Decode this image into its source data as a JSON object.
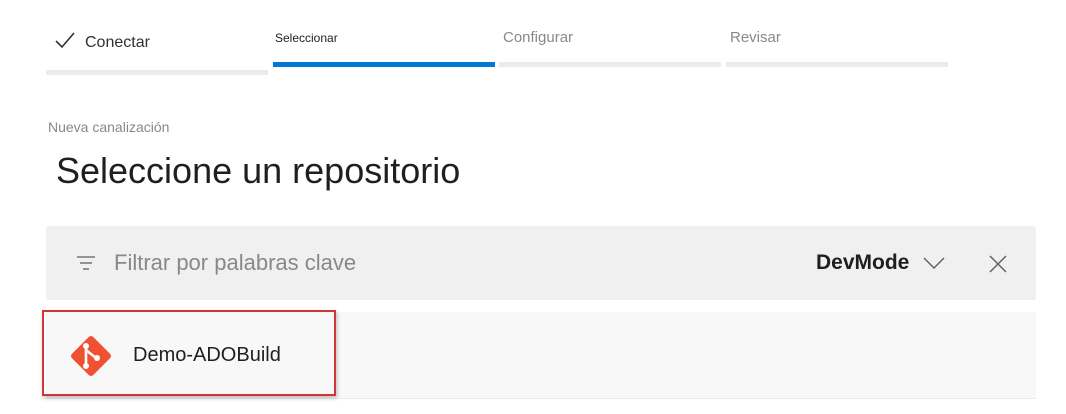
{
  "wizard": {
    "steps": [
      {
        "label": "Conectar",
        "state": "completed"
      },
      {
        "label": "Seleccionar",
        "state": "active"
      },
      {
        "label": "Configurar",
        "state": "upcoming"
      },
      {
        "label": "Revisar",
        "state": "upcoming"
      }
    ],
    "active_color": "#0078d4"
  },
  "header": {
    "subtitle": "Nueva canalización",
    "title": "Seleccione un repositorio"
  },
  "filter": {
    "icon": "filter-icon",
    "placeholder": "Filtrar por palabras clave",
    "value": "",
    "organization": "DevMode",
    "dropdown_icon": "chevron-down-icon",
    "clear_icon": "close-icon"
  },
  "repositories": [
    {
      "name": "Demo-ADOBuild",
      "icon": "git-icon",
      "icon_color": "#f05133",
      "highlighted": true
    }
  ],
  "colors": {
    "highlight": "#d13438",
    "filter_bar_bg": "#f0f0f0"
  }
}
